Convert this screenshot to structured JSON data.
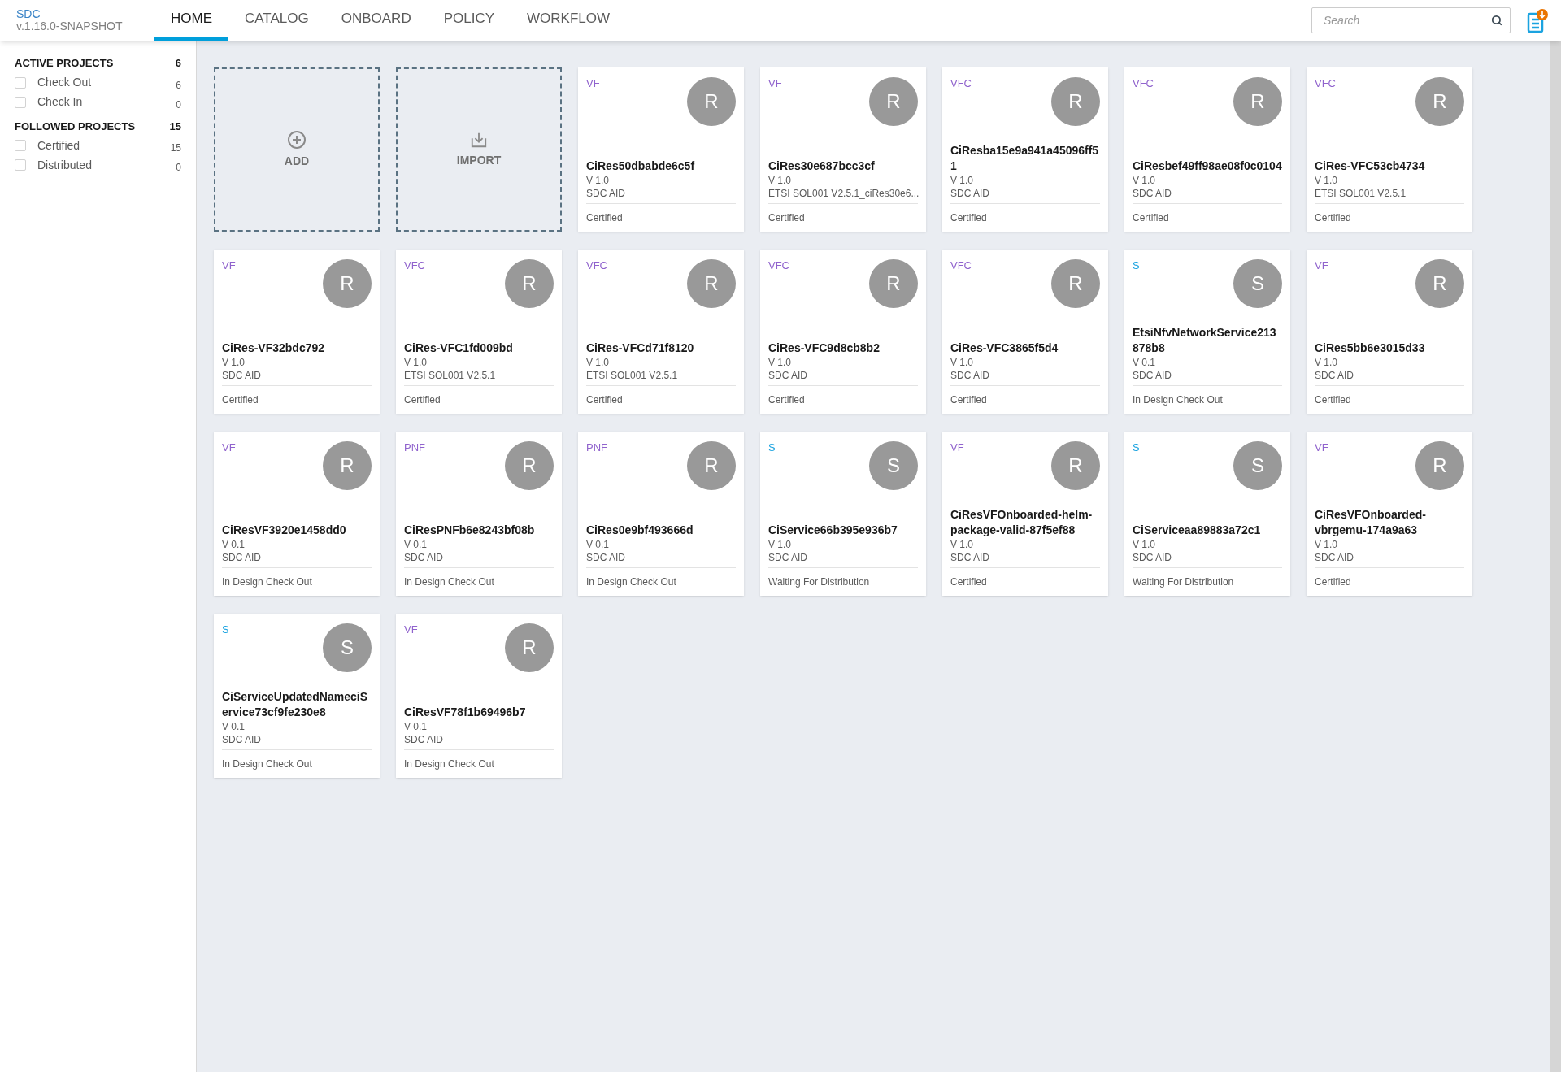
{
  "header": {
    "logo": "SDC",
    "version": "v.1.16.0-SNAPSHOT",
    "tabs": [
      {
        "label": "HOME",
        "selected": true
      },
      {
        "label": "CATALOG",
        "selected": false
      },
      {
        "label": "ONBOARD",
        "selected": false
      },
      {
        "label": "POLICY",
        "selected": false
      },
      {
        "label": "WORKFLOW",
        "selected": false
      }
    ],
    "search": {
      "placeholder": "Search"
    }
  },
  "sidebar": {
    "groups": [
      {
        "title": "ACTIVE PROJECTS",
        "count": "6",
        "items": [
          {
            "label": "Check Out",
            "count": "6",
            "checked": false
          },
          {
            "label": "Check In",
            "count": "0",
            "checked": false
          }
        ]
      },
      {
        "title": "FOLLOWED PROJECTS",
        "count": "15",
        "items": [
          {
            "label": "Certified",
            "count": "15",
            "checked": false
          },
          {
            "label": "Distributed",
            "count": "0",
            "checked": false
          }
        ]
      }
    ]
  },
  "tiles": [
    {
      "kind": "add",
      "label": "ADD"
    },
    {
      "kind": "import",
      "label": "IMPORT"
    }
  ],
  "cards": [
    {
      "type": "VF",
      "color": "#9063cd",
      "avatar": "R",
      "name": "CiRes50dbabde6c5f",
      "version": "V 1.0",
      "description": "SDC AID",
      "status": "Certified"
    },
    {
      "type": "VF",
      "color": "#9063cd",
      "avatar": "R",
      "name": "CiRes30e687bcc3cf",
      "version": "V 1.0",
      "description": "ETSI SOL001 V2.5.1_ciRes30e6...",
      "status": "Certified"
    },
    {
      "type": "VFC",
      "color": "#9063cd",
      "avatar": "R",
      "name": "CiResba15e9a941a45096ff51",
      "version": "V 1.0",
      "description": "SDC AID",
      "status": "Certified"
    },
    {
      "type": "VFC",
      "color": "#9063cd",
      "avatar": "R",
      "name": "CiResbef49ff98ae08f0c0104",
      "version": "V 1.0",
      "description": "SDC AID",
      "status": "Certified"
    },
    {
      "type": "VFC",
      "color": "#9063cd",
      "avatar": "R",
      "name": "CiRes-VFC53cb4734",
      "version": "V 1.0",
      "description": "ETSI SOL001 V2.5.1",
      "status": "Certified"
    },
    {
      "type": "VF",
      "color": "#9063cd",
      "avatar": "R",
      "name": "CiRes-VF32bdc792",
      "version": "V 1.0",
      "description": "SDC AID",
      "status": "Certified"
    },
    {
      "type": "VFC",
      "color": "#9063cd",
      "avatar": "R",
      "name": "CiRes-VFC1fd009bd",
      "version": "V 1.0",
      "description": "ETSI SOL001 V2.5.1",
      "status": "Certified"
    },
    {
      "type": "VFC",
      "color": "#9063cd",
      "avatar": "R",
      "name": "CiRes-VFCd71f8120",
      "version": "V 1.0",
      "description": "ETSI SOL001 V2.5.1",
      "status": "Certified"
    },
    {
      "type": "VFC",
      "color": "#9063cd",
      "avatar": "R",
      "name": "CiRes-VFC9d8cb8b2",
      "version": "V 1.0",
      "description": "SDC AID",
      "status": "Certified"
    },
    {
      "type": "VFC",
      "color": "#9063cd",
      "avatar": "R",
      "name": "CiRes-VFC3865f5d4",
      "version": "V 1.0",
      "description": "SDC AID",
      "status": "Certified"
    },
    {
      "type": "S",
      "color": "#1ba3e0",
      "avatar": "S",
      "name": "EtsiNfvNetworkService213878b8",
      "version": "V 0.1",
      "description": "SDC AID",
      "status": "In Design Check Out"
    },
    {
      "type": "VF",
      "color": "#9063cd",
      "avatar": "R",
      "name": "CiRes5bb6e3015d33",
      "version": "V 1.0",
      "description": "SDC AID",
      "status": "Certified"
    },
    {
      "type": "VF",
      "color": "#9063cd",
      "avatar": "R",
      "name": "CiResVF3920e1458dd0",
      "version": "V 0.1",
      "description": "SDC AID",
      "status": "In Design Check Out"
    },
    {
      "type": "PNF",
      "color": "#9063cd",
      "avatar": "R",
      "name": "CiResPNFb6e8243bf08b",
      "version": "V 0.1",
      "description": "SDC AID",
      "status": "In Design Check Out"
    },
    {
      "type": "PNF",
      "color": "#9063cd",
      "avatar": "R",
      "name": "CiRes0e9bf493666d",
      "version": "V 0.1",
      "description": "SDC AID",
      "status": "In Design Check Out"
    },
    {
      "type": "S",
      "color": "#1ba3e0",
      "avatar": "S",
      "name": "CiService66b395e936b7",
      "version": "V 1.0",
      "description": "SDC AID",
      "status": "Waiting For Distribution"
    },
    {
      "type": "VF",
      "color": "#9063cd",
      "avatar": "R",
      "name": "CiResVFOnboarded-helm-package-valid-87f5ef88",
      "version": "V 1.0",
      "description": "SDC AID",
      "status": "Certified"
    },
    {
      "type": "S",
      "color": "#1ba3e0",
      "avatar": "S",
      "name": "CiServiceaa89883a72c1",
      "version": "V 1.0",
      "description": "SDC AID",
      "status": "Waiting For Distribution"
    },
    {
      "type": "VF",
      "color": "#9063cd",
      "avatar": "R",
      "name": "CiResVFOnboarded-vbrgemu-174a9a63",
      "version": "V 1.0",
      "description": "SDC AID",
      "status": "Certified"
    },
    {
      "type": "S",
      "color": "#1ba3e0",
      "avatar": "S",
      "name": "CiServiceUpdatedNameciService73cf9fe230e8",
      "version": "V 0.1",
      "description": "SDC AID",
      "status": "In Design Check Out"
    },
    {
      "type": "VF",
      "color": "#9063cd",
      "avatar": "R",
      "name": "CiResVF78f1b69496b7",
      "version": "V 0.1",
      "description": "SDC AID",
      "status": "In Design Check Out"
    }
  ]
}
